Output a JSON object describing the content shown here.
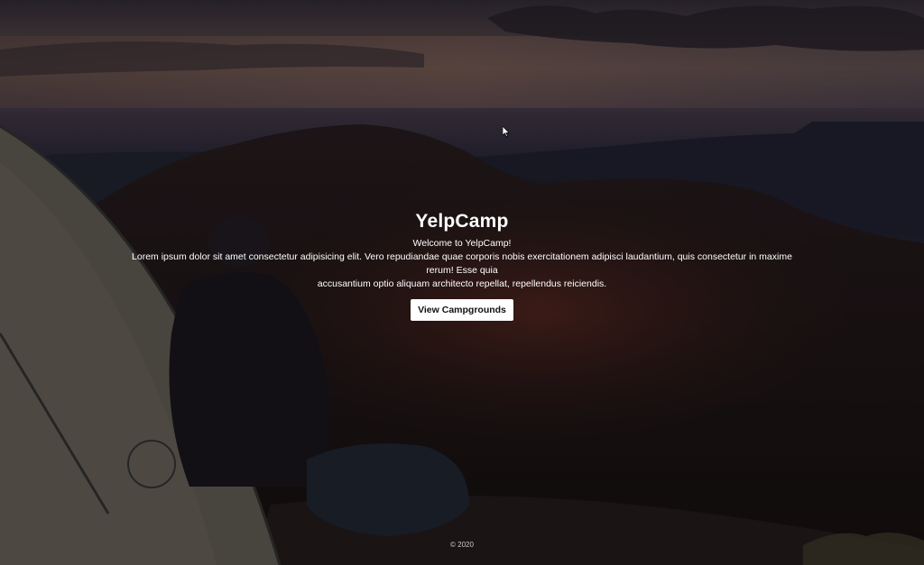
{
  "hero": {
    "title": "YelpCamp",
    "welcome": "Welcome to YelpCamp!",
    "description_line1": "Lorem ipsum dolor sit amet consectetur adipisicing elit. Vero repudiandae quae corporis nobis exercitationem adipisci laudantium, quis consectetur in maxime rerum! Esse quia",
    "description_line2": "accusantium optio aliquam architecto repellat, repellendus reiciendis.",
    "cta_label": "View Campgrounds"
  },
  "footer": {
    "copyright": "© 2020"
  },
  "colors": {
    "text": "#ffffff",
    "button_bg": "#ffffff",
    "button_text": "#111111"
  }
}
